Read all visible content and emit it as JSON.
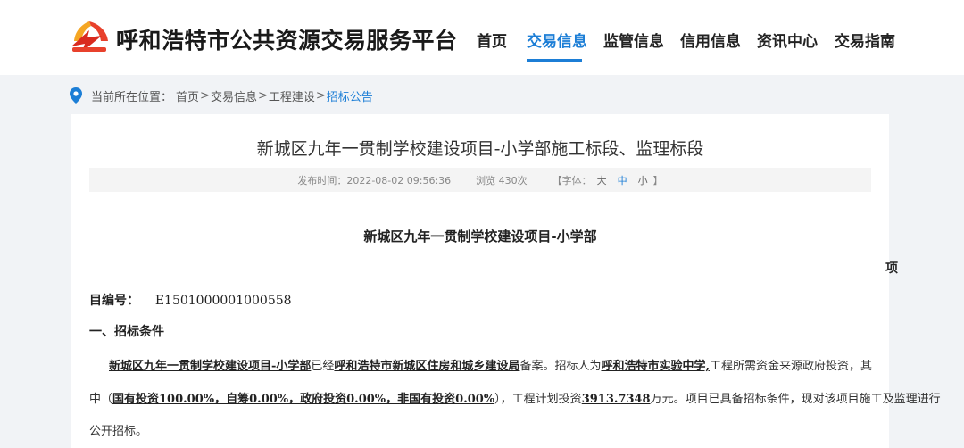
{
  "header": {
    "site_title": "呼和浩特市公共资源交易服务平台",
    "nav": [
      {
        "label": "首页"
      },
      {
        "label": "交易信息",
        "active": true
      },
      {
        "label": "监管信息"
      },
      {
        "label": "信用信息"
      },
      {
        "label": "资讯中心"
      },
      {
        "label": "交易指南"
      }
    ],
    "accent_color": "#1c7ed6"
  },
  "breadcrumb": {
    "prefix": "当前所在位置：",
    "items": [
      "首页",
      "交易信息",
      "工程建设",
      "招标公告"
    ],
    "separator": ">"
  },
  "article": {
    "title": "新城区九年一贯制学校建设项目-小学部施工标段、监理标段",
    "publish_time": "发布时间：2022-08-02 09:56:36",
    "views": "浏览 430次",
    "font_label_open": "【字体：",
    "font_sizes": [
      "大",
      "中",
      "小"
    ],
    "font_label_close": "】",
    "project_name": "新城区九年一贯制学校建设项目-小学部",
    "orphan_char": "项",
    "project_no_label": "目编号：",
    "project_no": "E1501000001000558",
    "section_1": "一、招标条件",
    "p1": {
      "a": "新城区九年一贯制学校建设项目-小学部",
      "b": "已经",
      "c": "呼和浩特市新城区住房和城乡建设局",
      "d": "备案。招标人为",
      "e": "呼和浩特市实验中学,",
      "f": "工程所需资金来源政府投资，其"
    },
    "p2": {
      "a": "中（",
      "b": "国有投资100.00%，自筹0.00%，政府投资0.00%，非国有投资0.00%",
      "c": "），工程计划投资",
      "d": "3913.7348",
      "e": "万元。项目已具备招标条件，现对该项目施工及监理进行"
    },
    "p3": "公开招标。"
  }
}
